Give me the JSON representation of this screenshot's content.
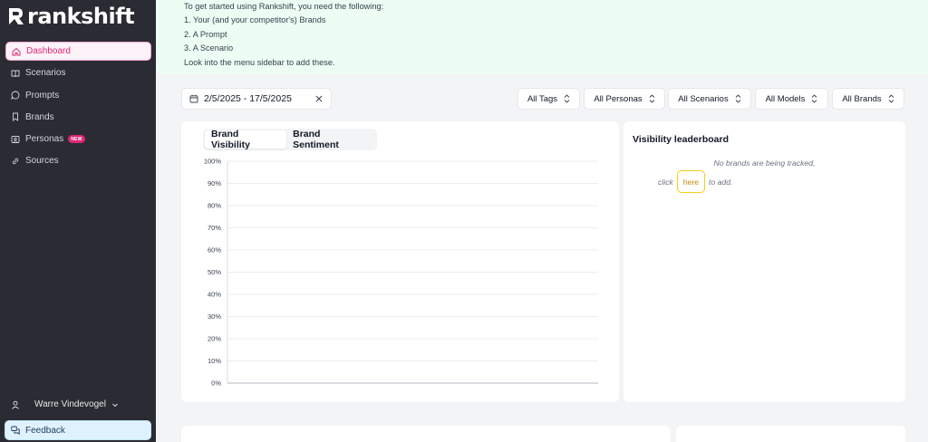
{
  "brand": {
    "logo_text": "rankshift"
  },
  "sidebar": {
    "items": [
      {
        "label": "Dashboard",
        "icon": "home-icon"
      },
      {
        "label": "Scenarios",
        "icon": "book-open-icon"
      },
      {
        "label": "Prompts",
        "icon": "message-circle-icon"
      },
      {
        "label": "Brands",
        "icon": "bookmark-icon"
      },
      {
        "label": "Personas",
        "icon": "id-card-icon",
        "badge": "NEW"
      },
      {
        "label": "Sources",
        "icon": "link-icon"
      }
    ],
    "user_name": "Warre Vindevogel",
    "feedback_label": "Feedback"
  },
  "banner": {
    "lines": [
      "To get started using Rankshift, you need the following:",
      "1. Your (and your competitor's) Brands",
      "2. A Prompt",
      "3. A Scenario",
      "Look into the menu sidebar to add these."
    ]
  },
  "filters": {
    "date_range": "2/5/2025 - 17/5/2025",
    "tags": "All Tags",
    "personas": "All Personas",
    "scenarios": "All Scenarios",
    "models": "All Models",
    "brands": "All Brands"
  },
  "chart_tabs": {
    "visibility": "Brand Visibility",
    "sentiment": "Brand Sentiment"
  },
  "leaderboard": {
    "title": "Visibility leaderboard",
    "empty_line1": "No brands are being tracked,",
    "click": "click",
    "here": "here",
    "to_add": "to add."
  },
  "chart_data": {
    "type": "line",
    "title": "",
    "series": [],
    "y_ticks": [
      "100%",
      "90%",
      "80%",
      "70%",
      "60%",
      "50%",
      "40%",
      "30%",
      "20%",
      "10%",
      "0%"
    ],
    "ylim": [
      0,
      100
    ],
    "grid": true
  },
  "colors": {
    "accent": "#db2777",
    "sidebar_bg": "#2b2b33",
    "banner_bg": "#ecfdf3",
    "here_border": "#facc15"
  }
}
